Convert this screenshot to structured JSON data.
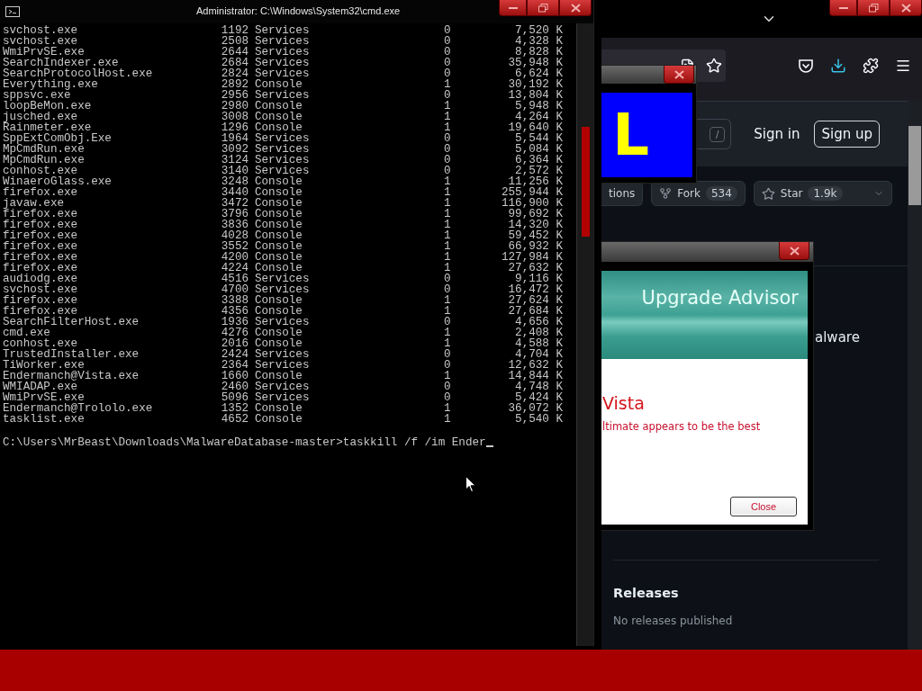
{
  "cmd_window": {
    "title": "Administrator: C:\\Windows\\System32\\cmd.exe",
    "processes": [
      {
        "name": "svchost.exe",
        "pid": "1192",
        "session": "Services",
        "session_no": "0",
        "mem": "7,520 K"
      },
      {
        "name": "svchost.exe",
        "pid": "2508",
        "session": "Services",
        "session_no": "0",
        "mem": "4,328 K"
      },
      {
        "name": "WmiPrvSE.exe",
        "pid": "2644",
        "session": "Services",
        "session_no": "0",
        "mem": "8,828 K"
      },
      {
        "name": "SearchIndexer.exe",
        "pid": "2684",
        "session": "Services",
        "session_no": "0",
        "mem": "35,948 K"
      },
      {
        "name": "SearchProtocolHost.exe",
        "pid": "2824",
        "session": "Services",
        "session_no": "0",
        "mem": "6,624 K"
      },
      {
        "name": "Everything.exe",
        "pid": "2892",
        "session": "Console",
        "session_no": "1",
        "mem": "30,192 K"
      },
      {
        "name": "sppsvc.exe",
        "pid": "2956",
        "session": "Services",
        "session_no": "0",
        "mem": "13,804 K"
      },
      {
        "name": "loopBeMon.exe",
        "pid": "2980",
        "session": "Console",
        "session_no": "1",
        "mem": "5,948 K"
      },
      {
        "name": "jusched.exe",
        "pid": "3008",
        "session": "Console",
        "session_no": "1",
        "mem": "4,264 K"
      },
      {
        "name": "Rainmeter.exe",
        "pid": "1296",
        "session": "Console",
        "session_no": "1",
        "mem": "19,640 K"
      },
      {
        "name": "SppExtComObj.Exe",
        "pid": "1964",
        "session": "Services",
        "session_no": "0",
        "mem": "5,544 K"
      },
      {
        "name": "MpCmdRun.exe",
        "pid": "3092",
        "session": "Services",
        "session_no": "0",
        "mem": "5,084 K"
      },
      {
        "name": "MpCmdRun.exe",
        "pid": "3124",
        "session": "Services",
        "session_no": "0",
        "mem": "6,364 K"
      },
      {
        "name": "conhost.exe",
        "pid": "3140",
        "session": "Services",
        "session_no": "0",
        "mem": "2,572 K"
      },
      {
        "name": "WinaeroGlass.exe",
        "pid": "3248",
        "session": "Console",
        "session_no": "1",
        "mem": "11,256 K"
      },
      {
        "name": "firefox.exe",
        "pid": "3440",
        "session": "Console",
        "session_no": "1",
        "mem": "255,944 K"
      },
      {
        "name": "javaw.exe",
        "pid": "3472",
        "session": "Console",
        "session_no": "1",
        "mem": "116,900 K"
      },
      {
        "name": "firefox.exe",
        "pid": "3796",
        "session": "Console",
        "session_no": "1",
        "mem": "99,692 K"
      },
      {
        "name": "firefox.exe",
        "pid": "3836",
        "session": "Console",
        "session_no": "1",
        "mem": "14,320 K"
      },
      {
        "name": "firefox.exe",
        "pid": "4028",
        "session": "Console",
        "session_no": "1",
        "mem": "59,452 K"
      },
      {
        "name": "firefox.exe",
        "pid": "3552",
        "session": "Console",
        "session_no": "1",
        "mem": "66,932 K"
      },
      {
        "name": "firefox.exe",
        "pid": "4200",
        "session": "Console",
        "session_no": "1",
        "mem": "127,984 K"
      },
      {
        "name": "firefox.exe",
        "pid": "4224",
        "session": "Console",
        "session_no": "1",
        "mem": "27,632 K"
      },
      {
        "name": "audiodg.exe",
        "pid": "4516",
        "session": "Services",
        "session_no": "0",
        "mem": "9,116 K"
      },
      {
        "name": "svchost.exe",
        "pid": "4700",
        "session": "Services",
        "session_no": "0",
        "mem": "16,472 K"
      },
      {
        "name": "firefox.exe",
        "pid": "3388",
        "session": "Console",
        "session_no": "1",
        "mem": "27,624 K"
      },
      {
        "name": "firefox.exe",
        "pid": "4356",
        "session": "Console",
        "session_no": "1",
        "mem": "27,684 K"
      },
      {
        "name": "SearchFilterHost.exe",
        "pid": "1936",
        "session": "Services",
        "session_no": "0",
        "mem": "4,656 K"
      },
      {
        "name": "cmd.exe",
        "pid": "4276",
        "session": "Console",
        "session_no": "1",
        "mem": "2,408 K"
      },
      {
        "name": "conhost.exe",
        "pid": "2016",
        "session": "Console",
        "session_no": "1",
        "mem": "4,588 K"
      },
      {
        "name": "TrustedInstaller.exe",
        "pid": "2424",
        "session": "Services",
        "session_no": "0",
        "mem": "4,704 K"
      },
      {
        "name": "TiWorker.exe",
        "pid": "2364",
        "session": "Services",
        "session_no": "0",
        "mem": "12,632 K"
      },
      {
        "name": "Endermanch@Vista.exe",
        "pid": "1660",
        "session": "Console",
        "session_no": "1",
        "mem": "14,844 K"
      },
      {
        "name": "WMIADAP.exe",
        "pid": "2460",
        "session": "Services",
        "session_no": "0",
        "mem": "4,748 K"
      },
      {
        "name": "WmiPrvSE.exe",
        "pid": "5096",
        "session": "Services",
        "session_no": "0",
        "mem": "5,424 K"
      },
      {
        "name": "Endermanch@Trololo.exe",
        "pid": "1352",
        "session": "Console",
        "session_no": "1",
        "mem": "36,072 K"
      },
      {
        "name": "tasklist.exe",
        "pid": "4652",
        "session": "Console",
        "session_no": "1",
        "mem": "5,540 K"
      }
    ],
    "prompt": "C:\\Users\\MrBeast\\Downloads\\MalwareDatabase-master>taskkill /f /im Ender"
  },
  "browser": {
    "header": {
      "search_key": "/",
      "sign_in": "Sign in",
      "sign_up": "Sign up"
    },
    "repo_actions": [
      {
        "kind": "plain",
        "label": "tions"
      },
      {
        "kind": "fork",
        "label": "Fork",
        "count": "534"
      },
      {
        "kind": "star",
        "label": "Star",
        "count": "1.9k"
      }
    ],
    "about_text": "alware",
    "releases": {
      "title": "Releases",
      "note": "No releases published"
    }
  },
  "banner_popup": {
    "text": "L"
  },
  "upgrade_advisor": {
    "banner_title": "Upgrade Advisor",
    "heading": "Vista",
    "message": "ltimate appears to be the best",
    "button": "Close"
  }
}
